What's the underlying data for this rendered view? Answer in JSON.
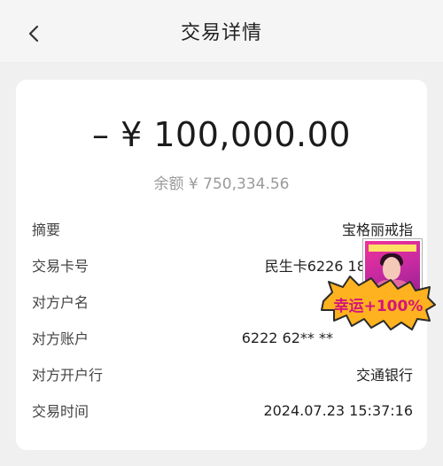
{
  "header": {
    "title": "交易详情",
    "back_icon": "chevron-left-icon"
  },
  "transaction": {
    "amount": "– ¥ 100,000.00",
    "balance": "余额 ¥ 750,334.56"
  },
  "details": [
    {
      "label": "摘要",
      "value": "宝格丽戒指"
    },
    {
      "label": "交易卡号",
      "value": "民生卡6226 18** ****"
    },
    {
      "label": "对方户名",
      "value": ""
    },
    {
      "label": "对方账户",
      "value": "6222 62** **"
    },
    {
      "label": "对方开户行",
      "value": "交通银行"
    },
    {
      "label": "交易时间",
      "value": "2024.07.23 15:37:16"
    }
  ],
  "sticker": {
    "icon": "lucky-sticker-icon",
    "text": "幸运+100%"
  },
  "colors": {
    "background": "#f0f0f0",
    "card": "#ffffff",
    "balance_text": "#9a9a9a",
    "sticker_fill": "#ffb21f"
  }
}
